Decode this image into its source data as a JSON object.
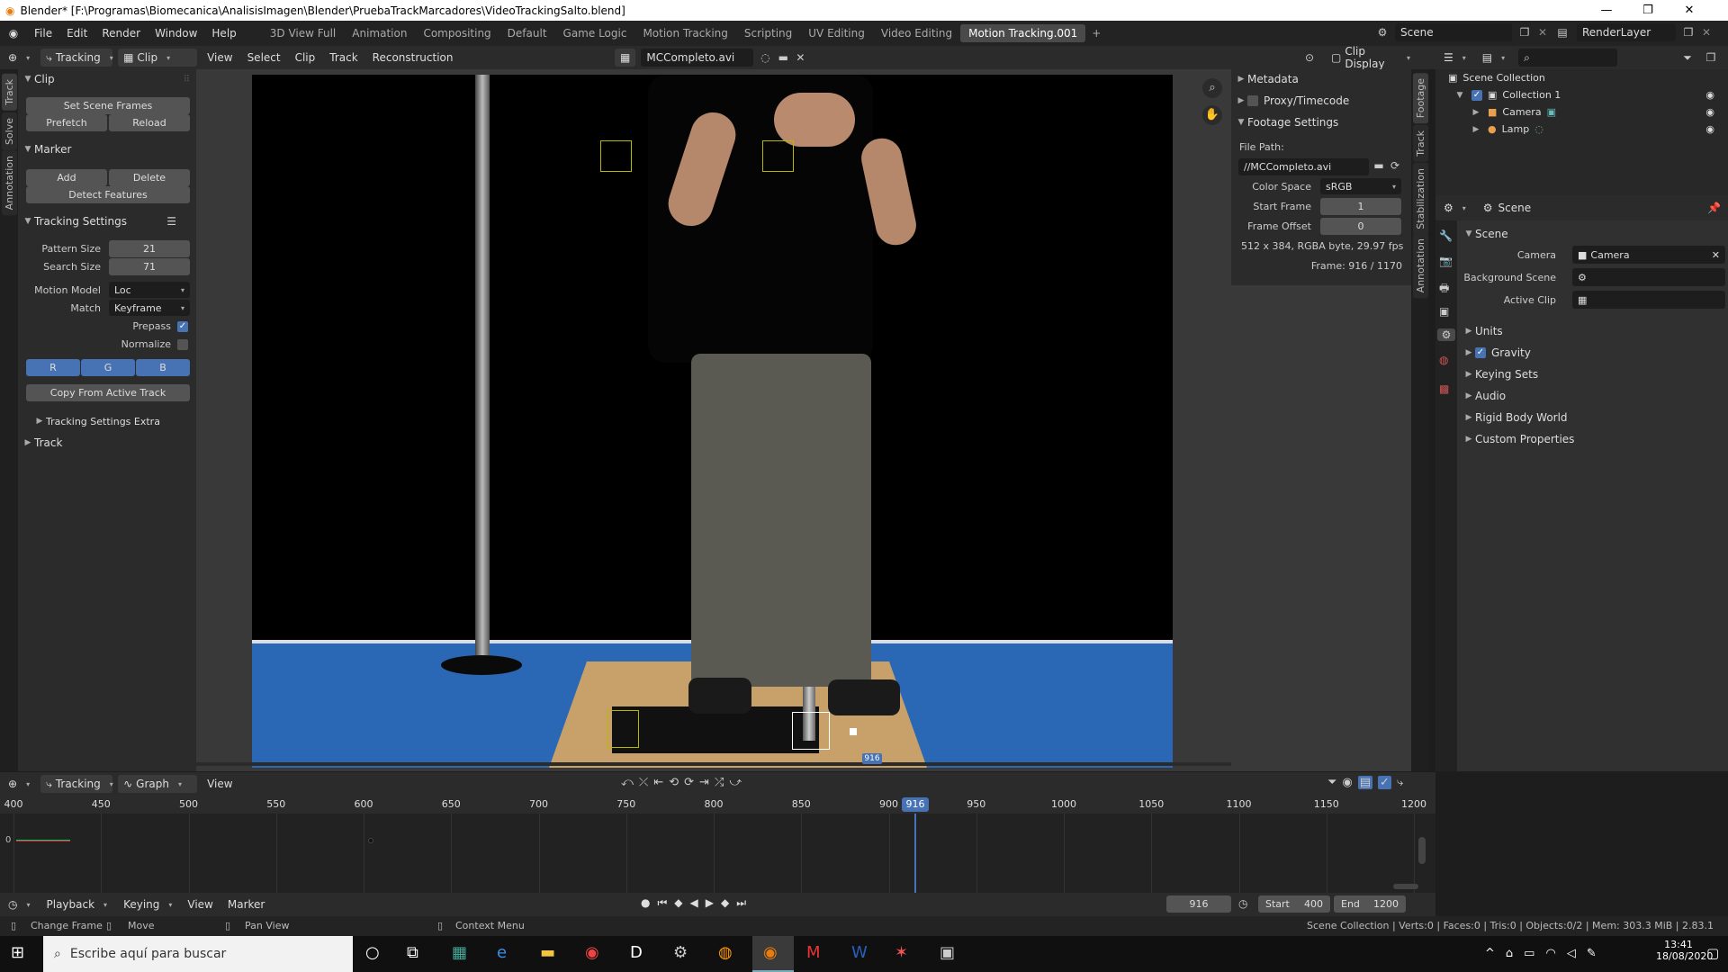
{
  "window": {
    "title": "Blender* [F:\\Programas\\Biomecanica\\AnalisisImagen\\Blender\\PruebaTrackMarcadores\\VideoTrackingSalto.blend]"
  },
  "menus": [
    "File",
    "Edit",
    "Render",
    "Window",
    "Help"
  ],
  "workspaces": [
    "3D View Full",
    "Animation",
    "Compositing",
    "Default",
    "Game Logic",
    "Motion Tracking",
    "Scripting",
    "UV Editing",
    "Video Editing",
    "Motion Tracking.001"
  ],
  "topright": {
    "scene": "Scene",
    "renderlayer": "RenderLayer"
  },
  "clip_header": {
    "mode": "Tracking",
    "view": "Clip",
    "menus": [
      "View",
      "Select",
      "Clip",
      "Track",
      "Reconstruction"
    ],
    "clip_name": "MCCompleto.avi",
    "display": "Clip Display"
  },
  "left_tabs": [
    "Track",
    "Solve",
    "Annotation"
  ],
  "left_panel": {
    "clip": {
      "title": "Clip",
      "set_scene_frames": "Set Scene Frames",
      "prefetch": "Prefetch",
      "reload": "Reload"
    },
    "marker": {
      "title": "Marker",
      "add": "Add",
      "delete": "Delete",
      "detect": "Detect Features"
    },
    "tracking": {
      "title": "Tracking Settings",
      "pattern_label": "Pattern Size",
      "pattern": "21",
      "search_label": "Search Size",
      "search": "71",
      "motion_label": "Motion Model",
      "motion": "Loc",
      "match_label": "Match",
      "match": "Keyframe",
      "prepass": "Prepass",
      "normalize": "Normalize",
      "r": "R",
      "g": "G",
      "b": "B",
      "copy": "Copy From Active Track",
      "extra": "Tracking Settings Extra"
    },
    "track": {
      "title": "Track"
    }
  },
  "right_clip_panel": {
    "metadata": "Metadata",
    "proxy": "Proxy/Timecode",
    "footage": "Footage Settings",
    "filepath_label": "File Path:",
    "filepath": "//MCCompleto.avi",
    "colorspace_label": "Color Space",
    "colorspace": "sRGB",
    "start_label": "Start Frame",
    "start": "1",
    "offset_label": "Frame Offset",
    "offset": "0",
    "info": "512 x 384, RGBA byte, 29.97 fps",
    "frame": "Frame: 916 / 1170"
  },
  "right_tabs": [
    "Footage",
    "Track",
    "Stabilization",
    "Annotation"
  ],
  "outliner": {
    "root": "Scene Collection",
    "collection": "Collection 1",
    "items": [
      "Camera",
      "Lamp"
    ]
  },
  "properties": {
    "header": "Scene",
    "section": "Scene",
    "camera_label": "Camera",
    "camera": "Camera",
    "bg_label": "Background Scene",
    "clip_label": "Active Clip",
    "sections": [
      "Units",
      "Gravity",
      "Keying Sets",
      "Audio",
      "Rigid Body World",
      "Custom Properties"
    ]
  },
  "frame_badge": "916",
  "graph_header": {
    "mode": "Tracking",
    "view": "Graph",
    "menu": "View"
  },
  "timeline_ticks": [
    "400",
    "450",
    "500",
    "550",
    "600",
    "650",
    "700",
    "750",
    "800",
    "850",
    "900",
    "950",
    "1000",
    "1050",
    "1100",
    "1150",
    "1200"
  ],
  "current_frame": "916",
  "graph_y_label": "0",
  "playback_bar": {
    "playback": "Playback",
    "keying": "Keying",
    "view": "View",
    "marker": "Marker",
    "frame": "916",
    "start_label": "Start",
    "start": "400",
    "end_label": "End",
    "end": "1200"
  },
  "status": {
    "change_frame": "Change Frame",
    "move": "Move",
    "pan": "Pan View",
    "context": "Context Menu",
    "stats": "Scene Collection | Verts:0 | Faces:0 | Tris:0 | Objects:0/2 | Mem: 303.3 MiB | 2.83.1"
  },
  "taskbar": {
    "search": "Escribe aquí para buscar",
    "time": "13:41",
    "date": "18/08/2020"
  }
}
